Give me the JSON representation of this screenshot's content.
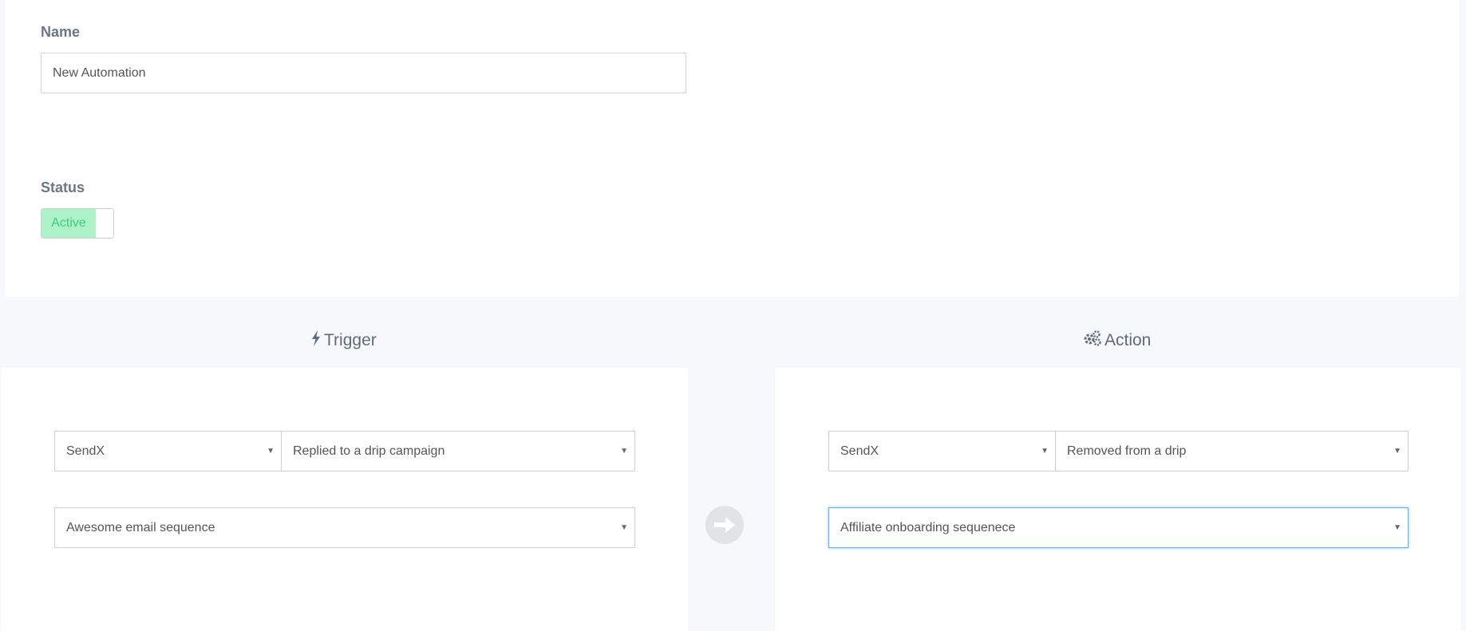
{
  "name_field": {
    "label": "Name",
    "value": "New Automation"
  },
  "status_field": {
    "label": "Status",
    "toggle_label": "Active"
  },
  "trigger": {
    "title": "Trigger",
    "icon": "bolt-icon",
    "app_select": "SendX",
    "event_select": "Replied to a drip campaign",
    "drip_select": "Awesome email sequence"
  },
  "action": {
    "title": "Action",
    "icon": "gears-icon",
    "app_select": "SendX",
    "event_select": "Removed from a drip",
    "drip_select": "Affiliate onboarding sequenece"
  },
  "connector_icon": "arrow-right-icon",
  "colors": {
    "toggle_bg": "#aef2c9",
    "toggle_text": "#3dcb7c",
    "focus_border": "#5fb1e8",
    "page_bg": "#f6f8fb"
  }
}
